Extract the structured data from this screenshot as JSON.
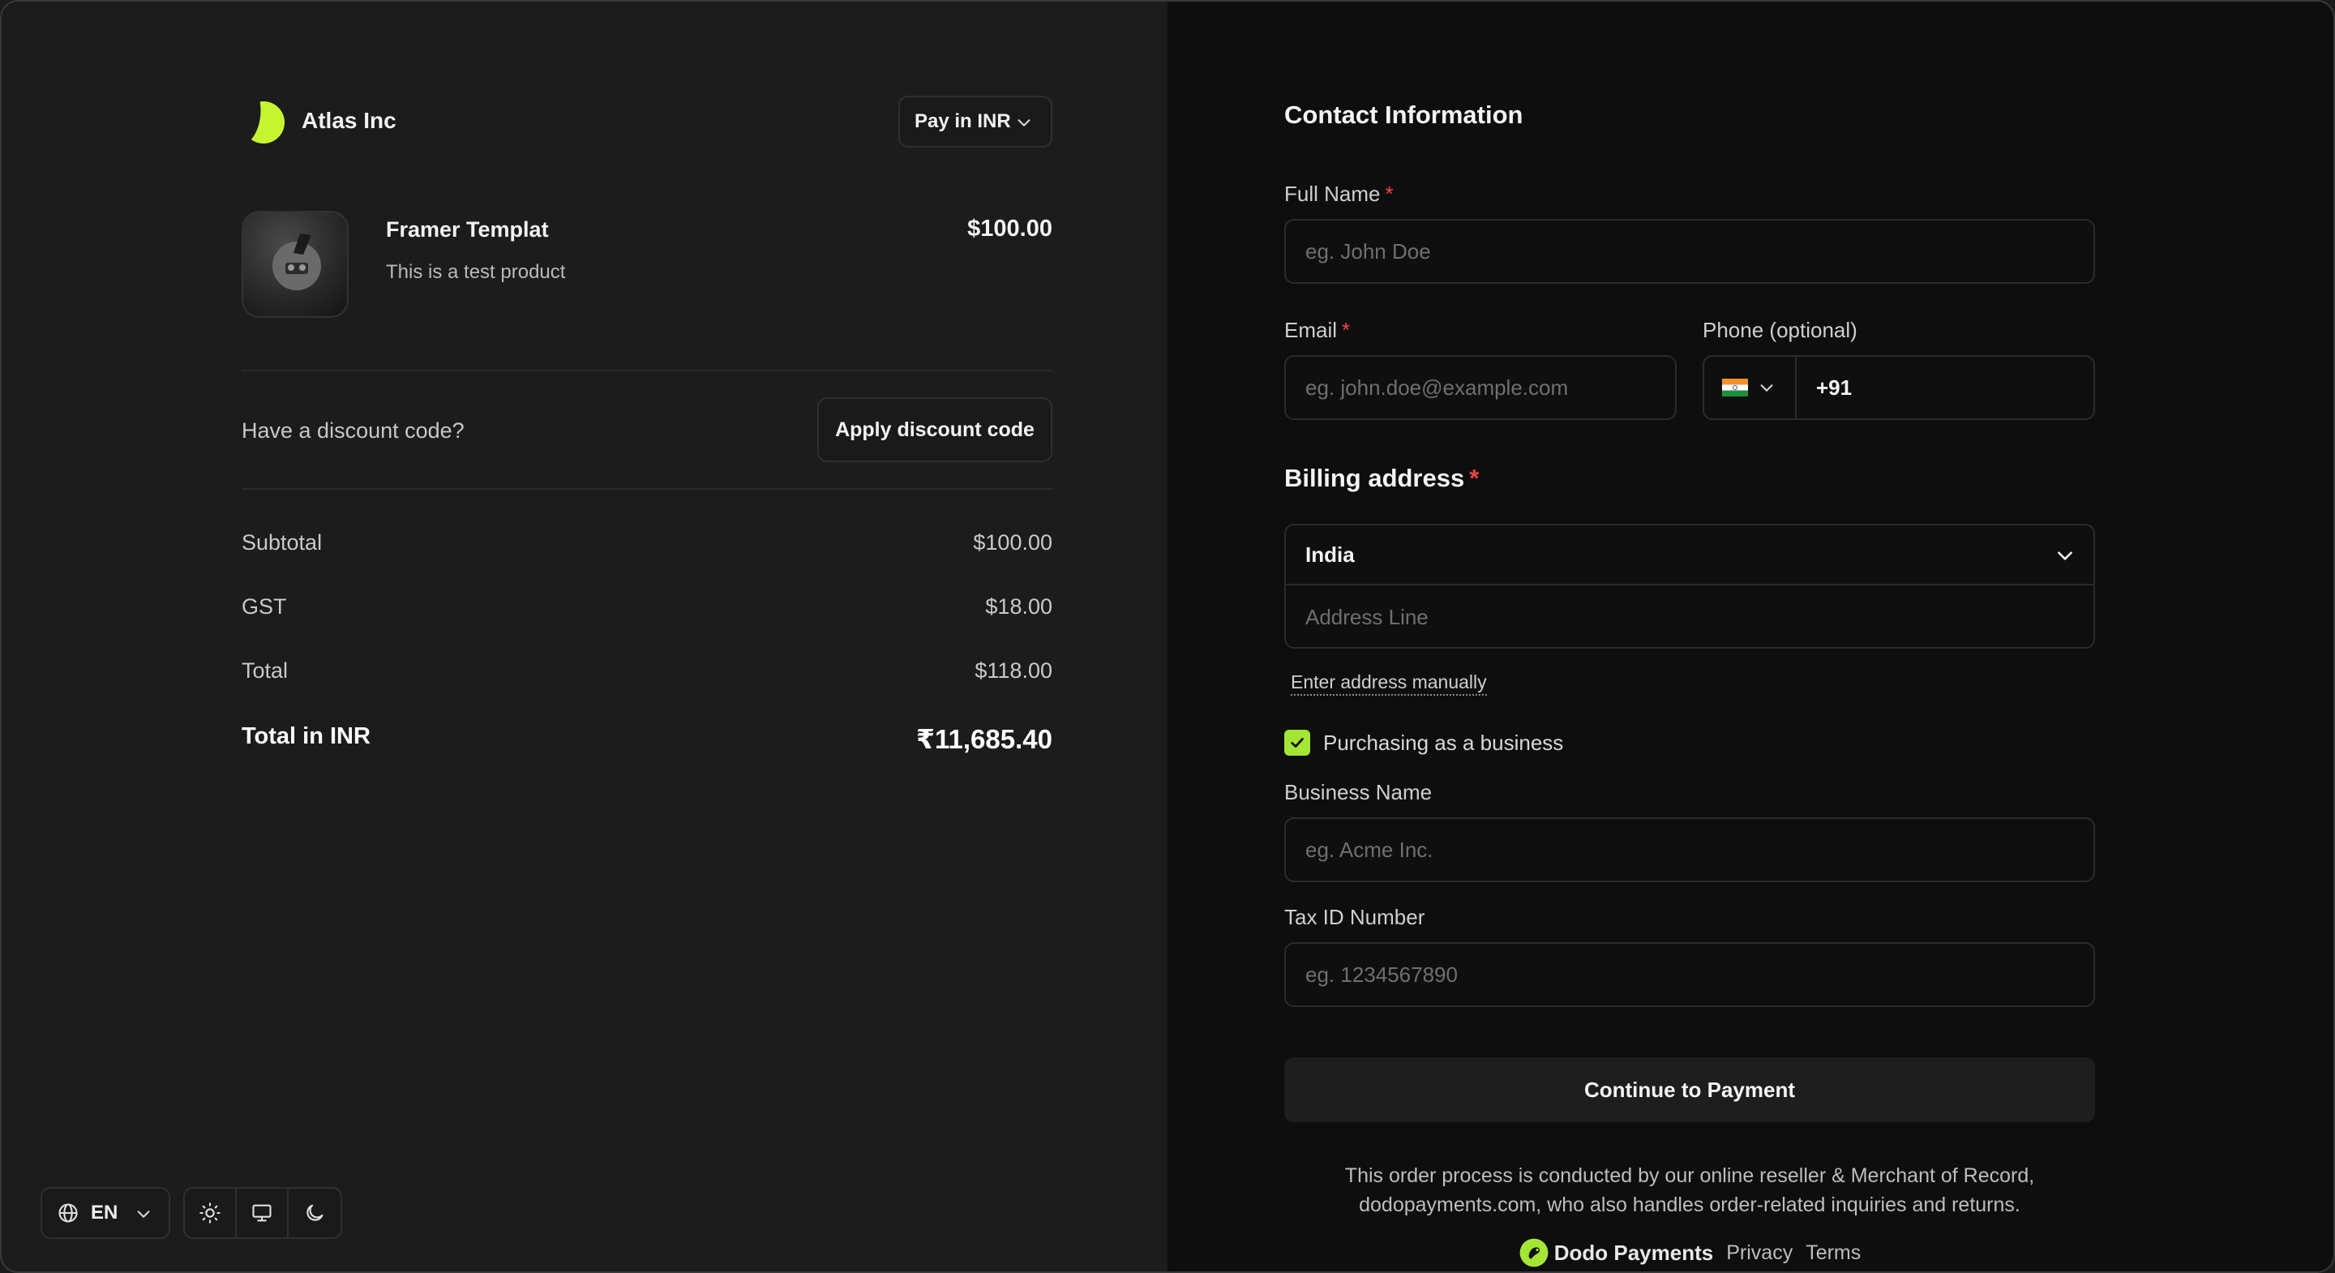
{
  "brand": {
    "name": "Atlas Inc"
  },
  "currency": {
    "label": "Pay in INR"
  },
  "product": {
    "title": "Framer Templat",
    "description": "This is a test product",
    "price": "$100.00"
  },
  "discount": {
    "prompt": "Have a discount code?",
    "button_label": "Apply discount code"
  },
  "summary": {
    "subtotal_label": "Subtotal",
    "subtotal_value": "$100.00",
    "tax_label": "GST",
    "tax_value": "$18.00",
    "total_label": "Total",
    "total_value": "$118.00",
    "total_local_label": "Total in INR",
    "total_local_value": "₹11,685.40"
  },
  "bottom_tools": {
    "language": "EN"
  },
  "contact": {
    "title": "Contact Information",
    "full_name_label": "Full Name",
    "full_name_placeholder": "eg. John Doe",
    "email_label": "Email",
    "email_placeholder": "eg. john.doe@example.com",
    "phone_label": "Phone (optional)",
    "phone_code": "+91",
    "required_mark": "*"
  },
  "billing": {
    "title": "Billing address",
    "country": "India",
    "address_placeholder": "Address Line",
    "manual_link": "Enter address manually",
    "business_checkbox_label": "Purchasing as a business",
    "business_checked": true,
    "business_name_label": "Business Name",
    "business_name_placeholder": "eg. Acme Inc.",
    "tax_id_label": "Tax ID Number",
    "tax_id_placeholder": "eg. 1234567890"
  },
  "actions": {
    "continue_label": "Continue to Payment"
  },
  "legal": {
    "line1": "This order process is conducted by our online reseller & Merchant of Record,",
    "line2": "dodopayments.com, who also handles order-related inquiries and returns."
  },
  "footer": {
    "brand": "Dodo Payments",
    "privacy": "Privacy",
    "terms": "Terms"
  },
  "colors": {
    "accent": "#a3e635",
    "required": "#ef4444"
  }
}
